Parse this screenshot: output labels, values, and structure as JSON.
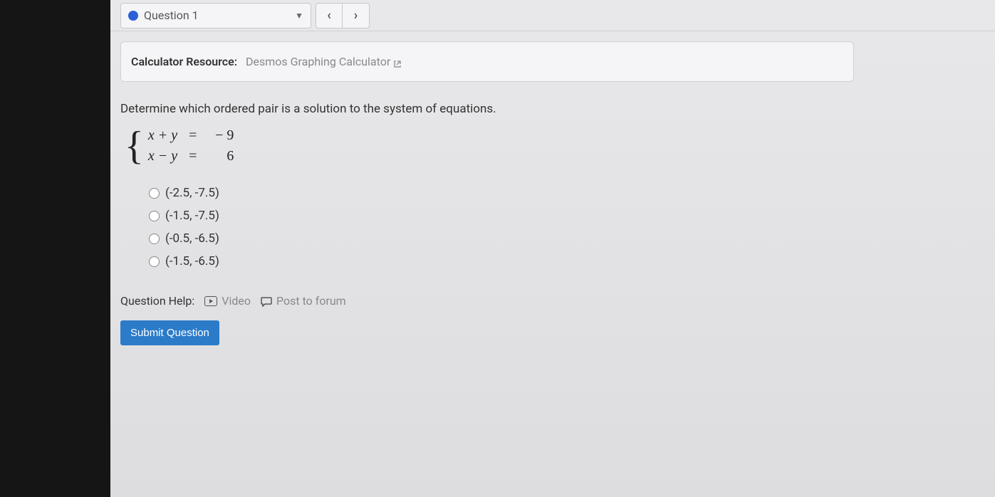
{
  "nav": {
    "question_label": "Question 1",
    "prev": "‹",
    "next": "›"
  },
  "resource": {
    "label": "Calculator Resource:",
    "link_text": "Desmos Graphing Calculator"
  },
  "prompt": "Determine which ordered pair is a solution to the system of equations.",
  "equations": {
    "row1_lhs": "x + y",
    "row1_op": "=",
    "row1_rhs": "− 9",
    "row2_lhs": "x − y",
    "row2_op": "=",
    "row2_rhs": "6"
  },
  "choices": [
    "(-2.5, -7.5)",
    "(-1.5, -7.5)",
    "(-0.5, -6.5)",
    "(-1.5, -6.5)"
  ],
  "help": {
    "label": "Question Help:",
    "video": "Video",
    "forum": "Post to forum"
  },
  "submit": "Submit Question"
}
